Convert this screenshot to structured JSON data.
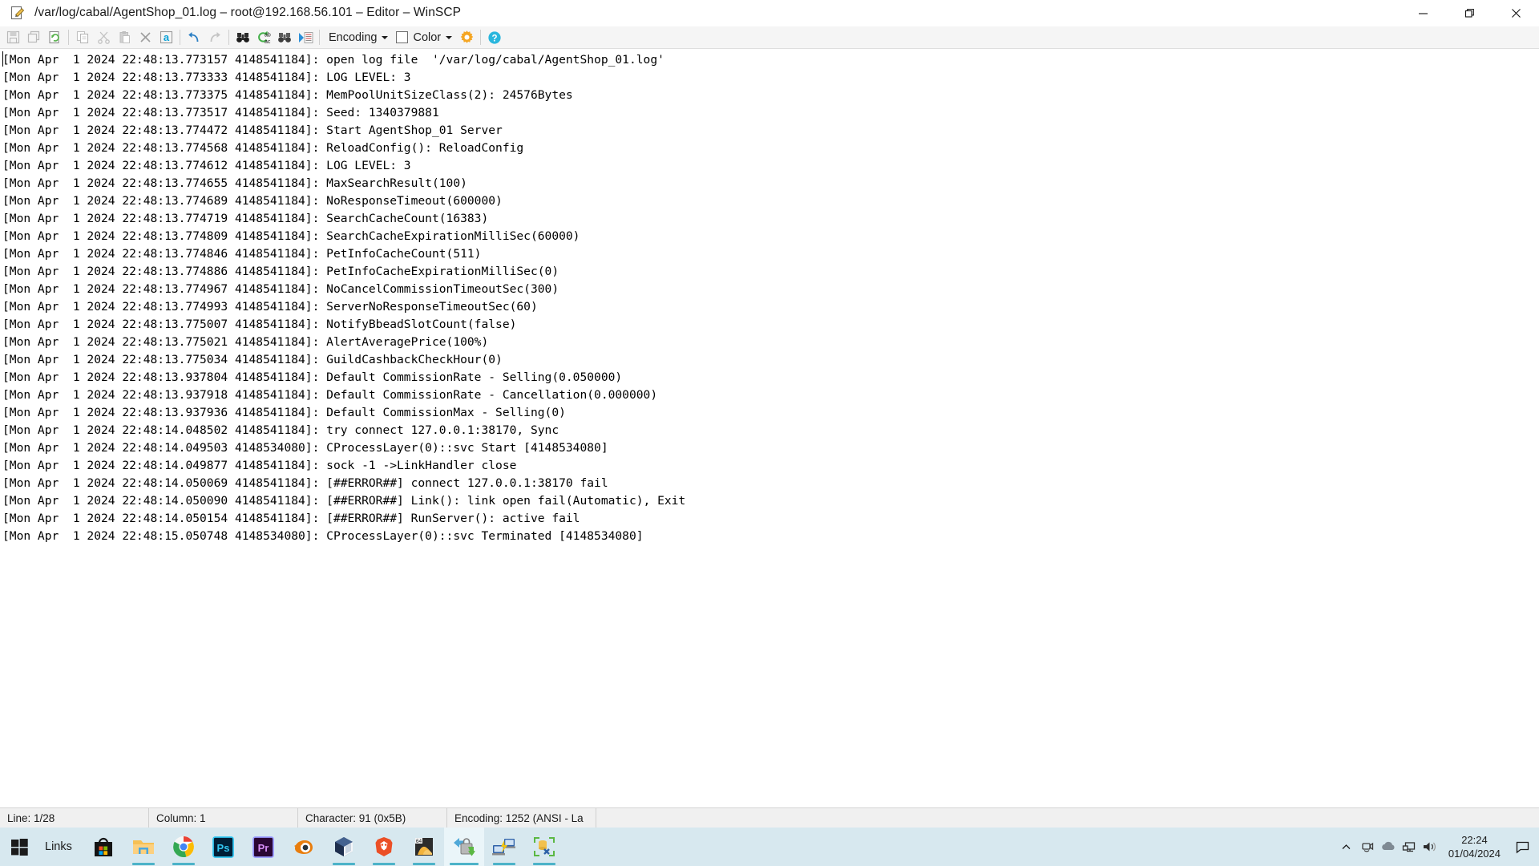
{
  "window": {
    "title": "/var/log/cabal/AgentShop_01.log – root@192.168.56.101 – Editor – WinSCP",
    "app_icon": "editor-document-pencil-icon",
    "controls": {
      "minimize": "minimize-icon",
      "restore": "restore-icon",
      "close": "close-icon"
    }
  },
  "toolbar": {
    "buttons": [
      {
        "name": "save-button",
        "icon": "floppy-disk-icon",
        "enabled": false
      },
      {
        "name": "save-as-button",
        "icon": "save-as-icon",
        "enabled": false
      },
      {
        "name": "reload-button",
        "icon": "reload-icon",
        "enabled": true
      },
      {
        "name": "copy-button",
        "icon": "copy-icon",
        "enabled": false
      },
      {
        "name": "cut-button",
        "icon": "scissors-icon",
        "enabled": false
      },
      {
        "name": "paste-button",
        "icon": "clipboard-icon",
        "enabled": false
      },
      {
        "name": "delete-button",
        "icon": "cross-icon",
        "enabled": false
      },
      {
        "name": "select-all-button",
        "icon": "letter-a-icon",
        "enabled": true
      },
      {
        "name": "undo-button",
        "icon": "undo-arrow-icon",
        "enabled": true
      },
      {
        "name": "redo-button",
        "icon": "redo-arrow-icon",
        "enabled": false
      },
      {
        "name": "find-button",
        "icon": "binoculars-icon",
        "enabled": true
      },
      {
        "name": "replace-button",
        "icon": "replace-abac-icon",
        "enabled": true
      },
      {
        "name": "find-next-button",
        "icon": "binoculars-next-icon",
        "enabled": true
      },
      {
        "name": "go-to-line-button",
        "icon": "goto-line-icon",
        "enabled": true
      }
    ],
    "encoding_label": "Encoding",
    "color_label": "Color",
    "settings_icon": "gear-icon",
    "help_icon": "help-circle-icon",
    "accent_gear_color": "#f5a623",
    "accent_help_color": "#29b6dd"
  },
  "editor": {
    "lines": [
      "[Mon Apr  1 2024 22:48:13.773157 4148541184]: open log file  '/var/log/cabal/AgentShop_01.log'",
      "[Mon Apr  1 2024 22:48:13.773333 4148541184]: LOG LEVEL: 3",
      "[Mon Apr  1 2024 22:48:13.773375 4148541184]: MemPoolUnitSizeClass(2): 24576Bytes",
      "[Mon Apr  1 2024 22:48:13.773517 4148541184]: Seed: 1340379881",
      "[Mon Apr  1 2024 22:48:13.774472 4148541184]: Start AgentShop_01 Server",
      "[Mon Apr  1 2024 22:48:13.774568 4148541184]: ReloadConfig(): ReloadConfig",
      "[Mon Apr  1 2024 22:48:13.774612 4148541184]: LOG LEVEL: 3",
      "[Mon Apr  1 2024 22:48:13.774655 4148541184]: MaxSearchResult(100)",
      "[Mon Apr  1 2024 22:48:13.774689 4148541184]: NoResponseTimeout(600000)",
      "[Mon Apr  1 2024 22:48:13.774719 4148541184]: SearchCacheCount(16383)",
      "[Mon Apr  1 2024 22:48:13.774809 4148541184]: SearchCacheExpirationMilliSec(60000)",
      "[Mon Apr  1 2024 22:48:13.774846 4148541184]: PetInfoCacheCount(511)",
      "[Mon Apr  1 2024 22:48:13.774886 4148541184]: PetInfoCacheExpirationMilliSec(0)",
      "[Mon Apr  1 2024 22:48:13.774967 4148541184]: NoCancelCommissionTimeoutSec(300)",
      "[Mon Apr  1 2024 22:48:13.774993 4148541184]: ServerNoResponseTimeoutSec(60)",
      "[Mon Apr  1 2024 22:48:13.775007 4148541184]: NotifyBbeadSlotCount(false)",
      "[Mon Apr  1 2024 22:48:13.775021 4148541184]: AlertAveragePrice(100%)",
      "[Mon Apr  1 2024 22:48:13.775034 4148541184]: GuildCashbackCheckHour(0)",
      "[Mon Apr  1 2024 22:48:13.937804 4148541184]: Default CommissionRate - Selling(0.050000)",
      "[Mon Apr  1 2024 22:48:13.937918 4148541184]: Default CommissionRate - Cancellation(0.000000)",
      "[Mon Apr  1 2024 22:48:13.937936 4148541184]: Default CommissionMax - Selling(0)",
      "[Mon Apr  1 2024 22:48:14.048502 4148541184]: try connect 127.0.0.1:38170, Sync",
      "[Mon Apr  1 2024 22:48:14.049503 4148534080]: CProcessLayer(0)::svc Start [4148534080]",
      "[Mon Apr  1 2024 22:48:14.049877 4148541184]: sock -1 ->LinkHandler close",
      "[Mon Apr  1 2024 22:48:14.050069 4148541184]: [##ERROR##] connect 127.0.0.1:38170 fail",
      "[Mon Apr  1 2024 22:48:14.050090 4148541184]: [##ERROR##] Link(): link open fail(Automatic), Exit",
      "[Mon Apr  1 2024 22:48:14.050154 4148541184]: [##ERROR##] RunServer(): active fail",
      "[Mon Apr  1 2024 22:48:15.050748 4148534080]: CProcessLayer(0)::svc Terminated [4148534080]"
    ]
  },
  "statusbar": {
    "line": "Line: 1/28",
    "column": "Column: 1",
    "character": "Character: 91 (0x5B)",
    "encoding": "Encoding: 1252  (ANSI - La"
  },
  "taskbar": {
    "start_icon": "windows-start-icon",
    "links_label": "Links",
    "apps": [
      {
        "name": "taskbar-item-microsoft-store",
        "icon": "microsoft-store-icon",
        "running": false,
        "active": false
      },
      {
        "name": "taskbar-item-file-explorer",
        "icon": "file-explorer-icon",
        "running": true,
        "active": false
      },
      {
        "name": "taskbar-item-google-chrome",
        "icon": "google-chrome-icon",
        "running": true,
        "active": false
      },
      {
        "name": "taskbar-item-photoshop",
        "icon": "photoshop-icon",
        "label": "Ps",
        "running": false,
        "active": false
      },
      {
        "name": "taskbar-item-premiere-pro",
        "icon": "premiere-pro-icon",
        "label": "Pr",
        "running": false,
        "active": false
      },
      {
        "name": "taskbar-item-blender",
        "icon": "blender-icon",
        "running": false,
        "active": false
      },
      {
        "name": "taskbar-item-virtualbox",
        "icon": "virtualbox-icon",
        "running": true,
        "active": false
      },
      {
        "name": "taskbar-item-brave-browser",
        "icon": "brave-lion-icon",
        "running": true,
        "active": false
      },
      {
        "name": "taskbar-item-image-editor",
        "icon": "image-editor-64-icon",
        "label": "64",
        "running": true,
        "active": false
      },
      {
        "name": "taskbar-item-winscp",
        "icon": "winscp-lock-icon",
        "running": true,
        "active": true
      },
      {
        "name": "taskbar-item-putty",
        "icon": "putty-terminal-icon",
        "running": true,
        "active": false
      },
      {
        "name": "taskbar-item-database-tool",
        "icon": "database-tool-icon",
        "running": true,
        "active": false
      }
    ],
    "tray": {
      "expand_icon": "chevron-up-icon",
      "icons": [
        {
          "name": "tray-icon-camera",
          "icon": "webcam-icon"
        },
        {
          "name": "tray-icon-onedrive",
          "icon": "cloud-icon"
        },
        {
          "name": "tray-icon-network",
          "icon": "monitor-network-icon"
        },
        {
          "name": "tray-icon-volume",
          "icon": "speaker-icon"
        }
      ],
      "time": "22:24",
      "date": "01/04/2024",
      "notification_icon": "action-center-icon"
    },
    "background_color": "#d7e8ef"
  }
}
